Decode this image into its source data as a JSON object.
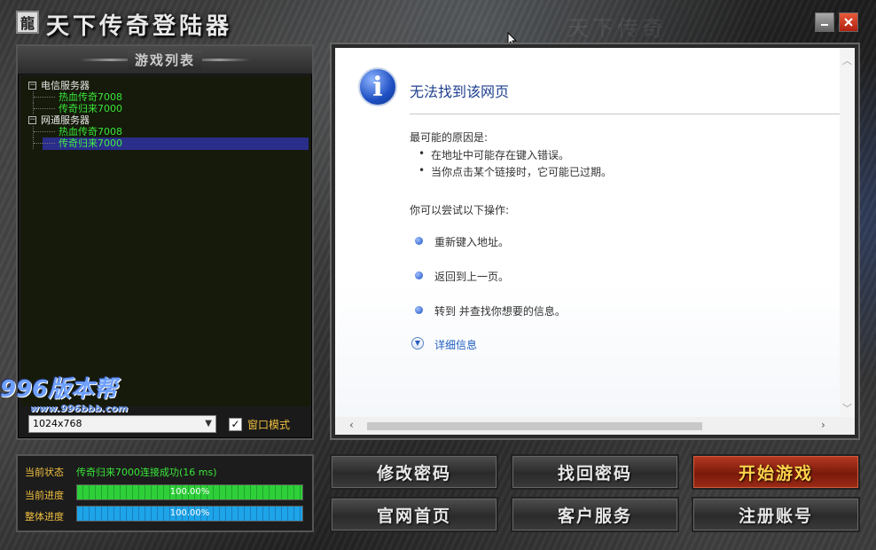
{
  "window": {
    "logo_char": "龍",
    "title": "天下传奇登陆器",
    "watermark_title": "天下传奇"
  },
  "game_list": {
    "title": "游戏列表",
    "groups": [
      {
        "label": "电信服务器",
        "items": [
          "热血传奇7008",
          "传奇归来7000"
        ]
      },
      {
        "label": "网通服务器",
        "items": [
          "热血传奇7008",
          "传奇归来7000"
        ]
      }
    ],
    "selected": {
      "group": 1,
      "item": 1
    }
  },
  "resolution": {
    "value": "1024x768"
  },
  "window_mode": {
    "label": "窗口模式",
    "checked": true
  },
  "watermark": {
    "brand": "996版本帮",
    "url": "www.996bbb.com"
  },
  "browser": {
    "page_title": "无法找到该网页",
    "reason_heading": "最可能的原因是:",
    "reasons": [
      "在地址中可能存在键入错误。",
      "当你点击某个链接时，它可能已过期。"
    ],
    "try_heading": "你可以尝试以下操作:",
    "actions": [
      "重新键入地址。",
      "返回到上一页。",
      "转到  并查找你想要的信息。"
    ],
    "details_link": "详细信息"
  },
  "status": {
    "current_status_label": "当前状态",
    "current_status_text": "传奇归来7000连接成功(16 ms)",
    "current_progress_label": "当前进度",
    "current_progress": 1.0,
    "current_progress_text": "100.00%",
    "overall_progress_label": "整体进度",
    "overall_progress": 1.0,
    "overall_progress_text": "100.00%"
  },
  "buttons": {
    "change_password": "修改密码",
    "recover_password": "找回密码",
    "start_game": "开始游戏",
    "official_site": "官网首页",
    "customer_service": "客户服务",
    "register": "注册账号"
  },
  "colors": {
    "tree_item": "#39e639",
    "selection": "#2a2e8a",
    "label_gold": "#f0c040",
    "start_button": "#9c2a16",
    "link_blue": "#1f5fbf"
  }
}
